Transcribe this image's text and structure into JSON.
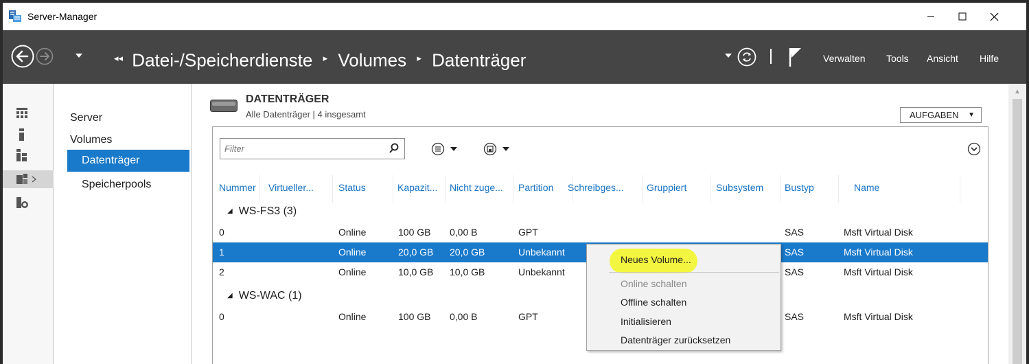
{
  "window": {
    "title": "Server-Manager"
  },
  "header": {
    "breadcrumb": [
      "Datei-/Speicherdienste",
      "Volumes",
      "Datenträger"
    ],
    "menu": [
      "Verwalten",
      "Tools",
      "Ansicht",
      "Hilfe"
    ]
  },
  "nav": {
    "items": [
      "Server",
      "Volumes",
      "Datenträger",
      "Speicherpools"
    ],
    "selected": "Datenträger"
  },
  "section": {
    "title": "DATENTRÄGER",
    "subtitle": "Alle Datenträger | 4 insgesamt",
    "tasks_label": "AUFGABEN"
  },
  "filter": {
    "placeholder": "Filter"
  },
  "table": {
    "columns": [
      "Nummer",
      "Virtueller...",
      "Status",
      "Kapazit...",
      "Nicht zuge...",
      "Partition",
      "Schreibges...",
      "Gruppiert",
      "Subsystem",
      "Bustyp",
      "Name"
    ],
    "groups": [
      {
        "label": "WS-FS3 (3)",
        "rows": [
          {
            "nummer": "0",
            "status": "Online",
            "kapazitaet": "100 GB",
            "nicht_zugeordnet": "0,00 B",
            "partition": "GPT",
            "bustyp": "SAS",
            "name": "Msft Virtual Disk"
          },
          {
            "nummer": "1",
            "status": "Online",
            "kapazitaet": "20,0 GB",
            "nicht_zugeordnet": "20,0 GB",
            "partition": "Unbekannt",
            "bustyp": "SAS",
            "name": "Msft Virtual Disk",
            "selected": true
          },
          {
            "nummer": "2",
            "status": "Online",
            "kapazitaet": "10,0 GB",
            "nicht_zugeordnet": "10,0 GB",
            "partition": "Unbekannt",
            "bustyp": "SAS",
            "name": "Msft Virtual Disk"
          }
        ]
      },
      {
        "label": "WS-WAC (1)",
        "rows": [
          {
            "nummer": "0",
            "status": "Online",
            "kapazitaet": "100 GB",
            "nicht_zugeordnet": "0,00 B",
            "partition": "GPT",
            "bustyp": "SAS",
            "name": "Msft Virtual Disk"
          }
        ]
      }
    ]
  },
  "context_menu": {
    "items": [
      {
        "label": "Neues Volume...",
        "enabled": true,
        "highlighted": true
      },
      {
        "label": "Online schalten",
        "enabled": false
      },
      {
        "label": "Offline schalten",
        "enabled": true
      },
      {
        "label": "Initialisieren",
        "enabled": true
      },
      {
        "label": "Datenträger zurücksetzen",
        "enabled": true
      }
    ]
  },
  "icons": {
    "app": "server-manager-icon",
    "back": "back-arrow-icon",
    "forward": "forward-arrow-icon",
    "refresh": "refresh-icon",
    "notifications": "flag-icon",
    "filter": "search-icon",
    "list_options": "list-options-icon",
    "save": "save-icon",
    "expand": "chevron-down-circle-icon"
  },
  "colors": {
    "header_bg": "#454545",
    "selection": "#1979ca",
    "column_header": "#1672c3",
    "highlight": "#f2f536"
  }
}
